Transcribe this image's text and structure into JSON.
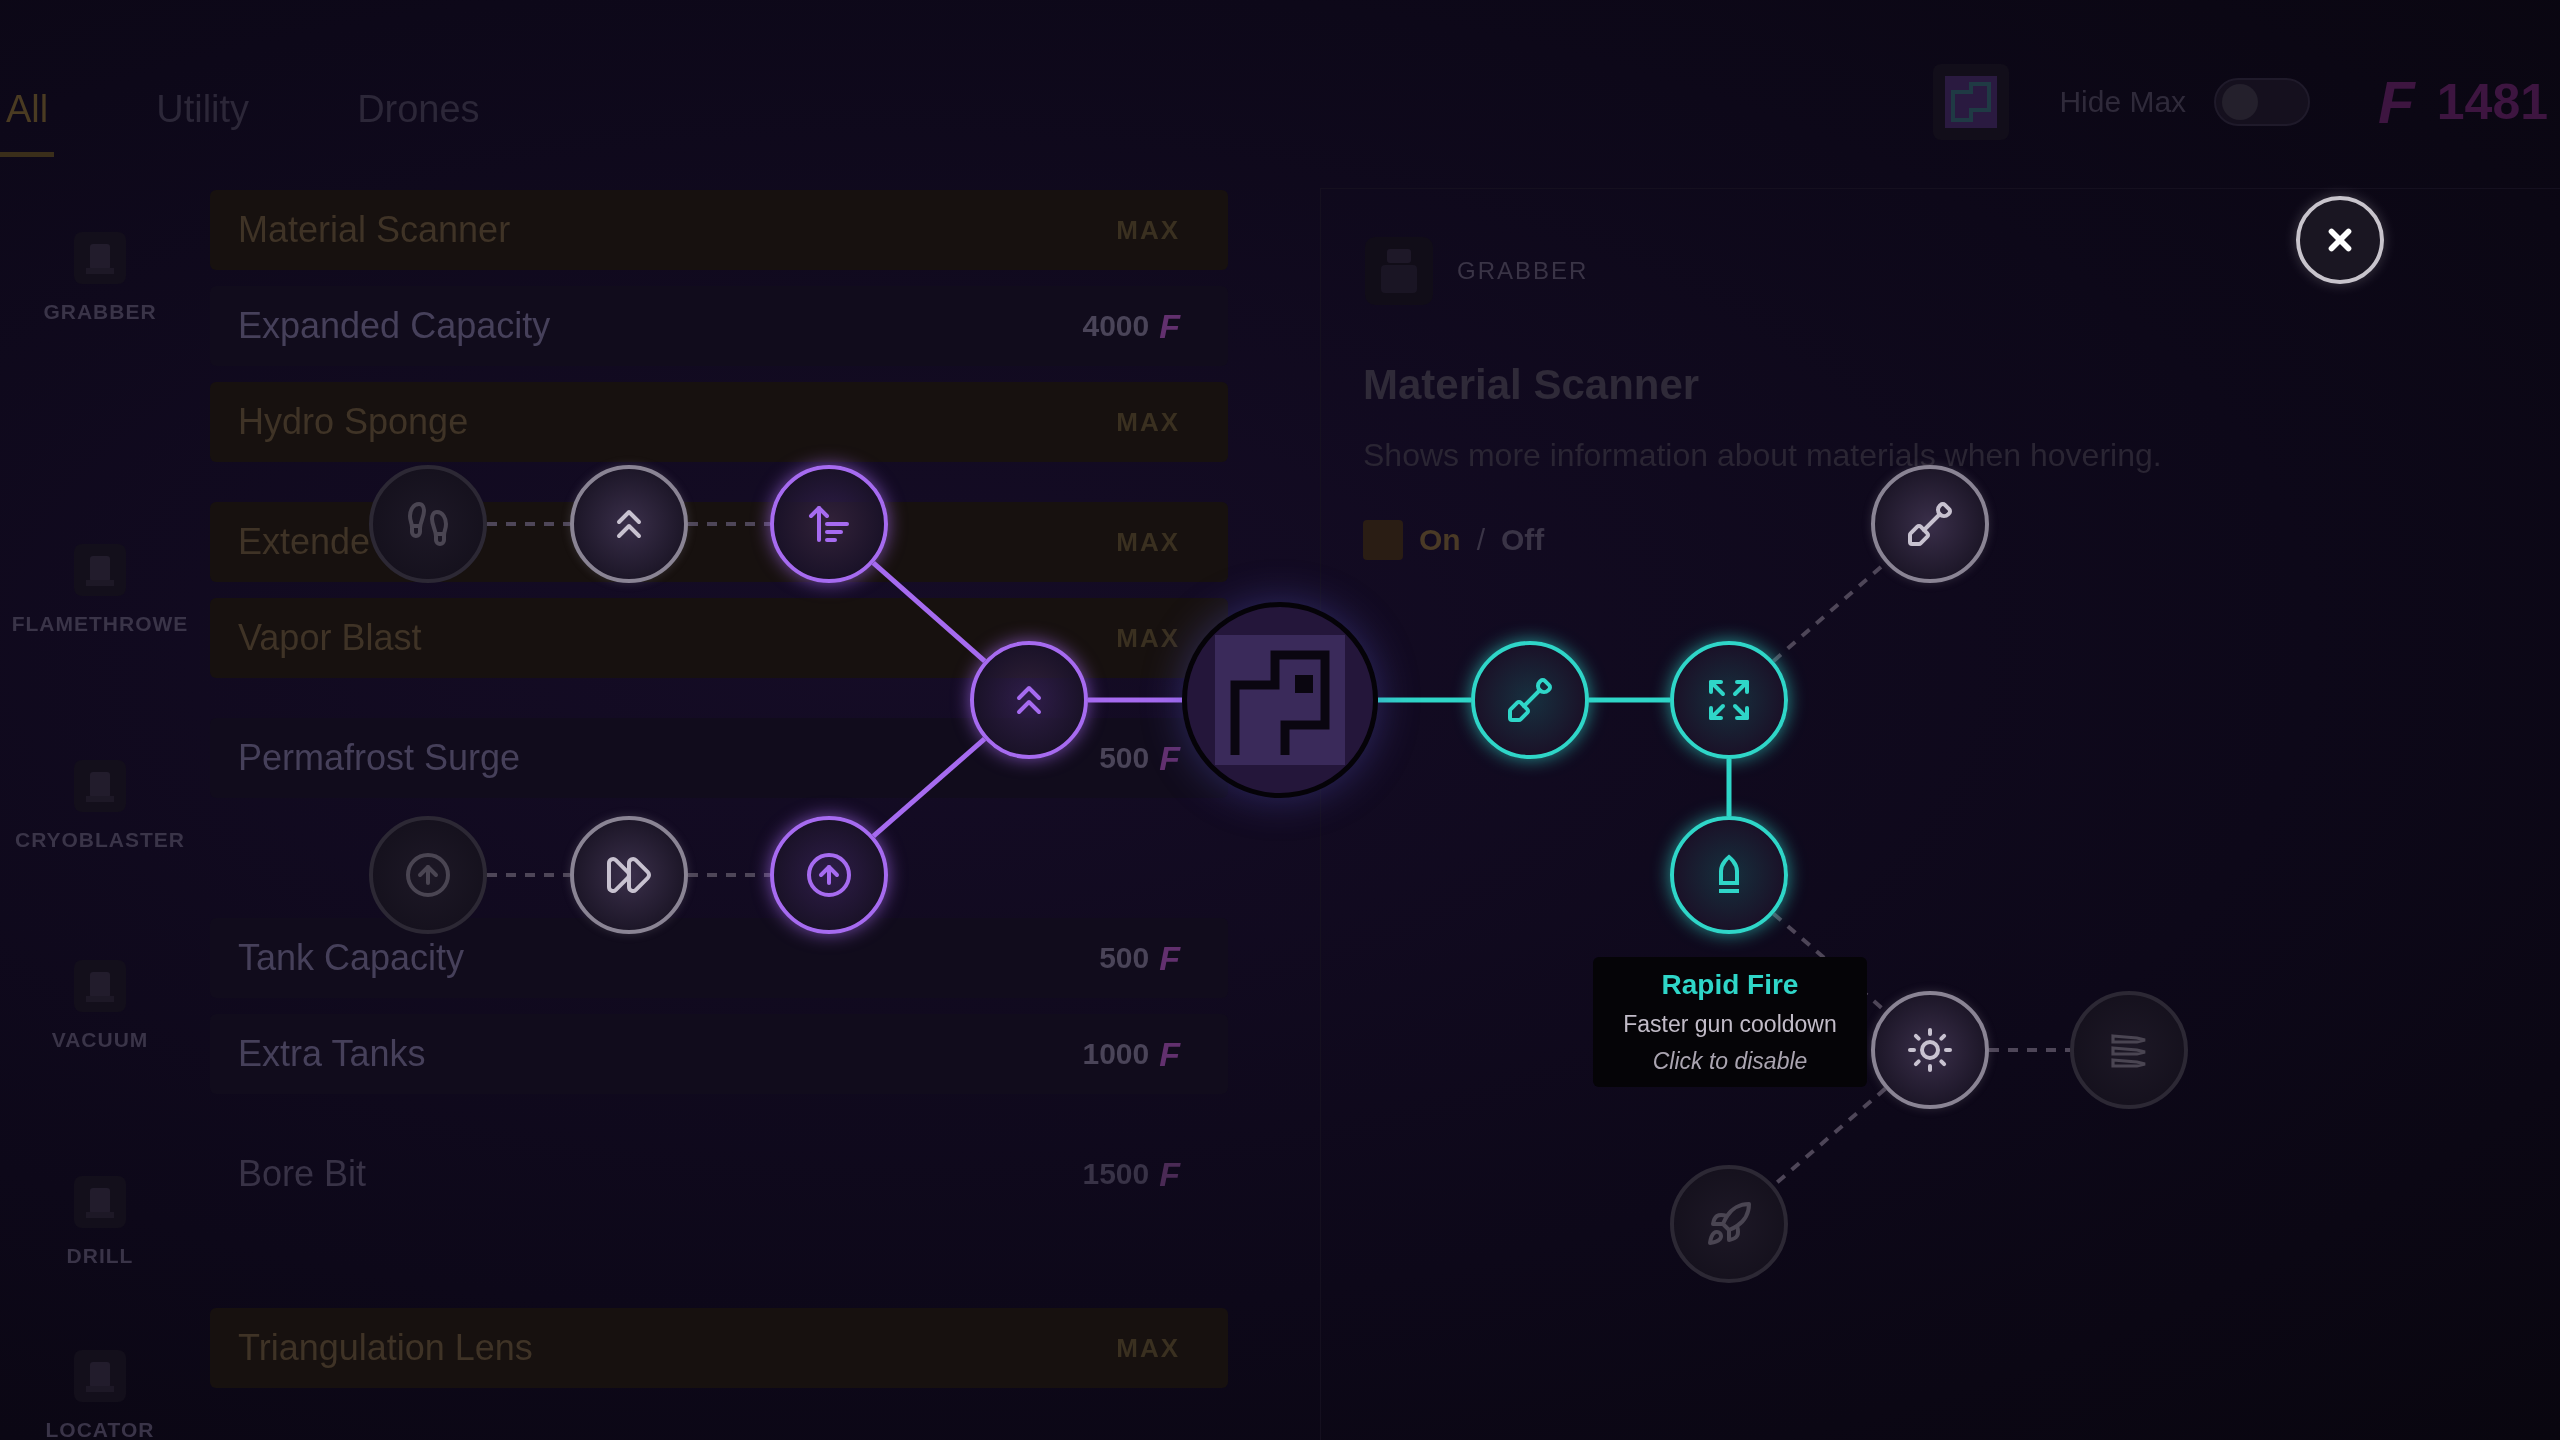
{
  "tabs": [
    {
      "label": "All",
      "selected": true
    },
    {
      "label": "Utility",
      "selected": false
    },
    {
      "label": "Drones",
      "selected": false
    }
  ],
  "header": {
    "hide_max": {
      "label": "Hide Max",
      "on": false
    },
    "currency_symbol": "F",
    "balance": "1481"
  },
  "groups": [
    {
      "label": "GRABBER",
      "upgrades": [
        {
          "name": "Material Scanner",
          "kind": "maxed",
          "status": "MAX"
        },
        {
          "name": "Expanded Capacity",
          "kind": "priced",
          "price": "4000",
          "currency": "F"
        },
        {
          "name": "Hydro Sponge",
          "kind": "maxed",
          "status": "MAX"
        }
      ]
    },
    {
      "label": "FLAMETHROWE",
      "upgrades": [
        {
          "name": "Extende",
          "kind": "maxed",
          "status": "MAX"
        },
        {
          "name": "Vapor Blast",
          "kind": "maxed",
          "status": "MAX"
        }
      ]
    },
    {
      "label": "CRYOBLASTER",
      "upgrades": [
        {
          "name": "Permafrost Surge",
          "kind": "priced",
          "price": "500",
          "currency": "F"
        }
      ]
    },
    {
      "label": "VACUUM",
      "upgrades": [
        {
          "name": "Tank Capacity",
          "kind": "priced",
          "price": "500",
          "currency": "F"
        },
        {
          "name": "Extra Tanks",
          "kind": "priced",
          "price": "1000",
          "currency": "F"
        }
      ]
    },
    {
      "label": "DRILL",
      "upgrades": [
        {
          "name": "Bore Bit",
          "kind": "unaffordable",
          "price": "1500",
          "currency": "F"
        }
      ]
    },
    {
      "label": "LOCATOR",
      "upgrades": [
        {
          "name": "Triangulation Lens",
          "kind": "maxed",
          "status": "MAX"
        }
      ]
    }
  ],
  "detail": {
    "category": "GRABBER",
    "title": "Material Scanner",
    "description": "Shows more information about materials when hovering.",
    "toggle": {
      "checked": true,
      "on_label": "On",
      "separator": "/",
      "off_label": "Off"
    }
  },
  "skill_tree": {
    "nodes": [
      {
        "active": false,
        "locked": true
      },
      {
        "active": false,
        "locked": false
      },
      {
        "active": true,
        "color": "#a66bf0"
      },
      {
        "active": true,
        "color": "#a66bf0"
      },
      {
        "active": false,
        "locked": true
      },
      {
        "active": false,
        "locked": false
      },
      {
        "active": true,
        "color": "#a66bf0"
      },
      {
        "active": true,
        "color": "#2fd6c8"
      },
      {
        "active": true,
        "color": "#2fd6c8"
      },
      {
        "active": true,
        "color": "#2fd6c8"
      },
      {
        "active": false,
        "locked": false
      },
      {
        "active": false,
        "locked": false
      },
      {
        "active": false,
        "locked": true
      },
      {
        "active": false,
        "locked": true
      }
    ],
    "tooltip": {
      "title": "Rapid Fire",
      "description": "Faster gun cooldown",
      "hint": "Click to disable"
    }
  }
}
